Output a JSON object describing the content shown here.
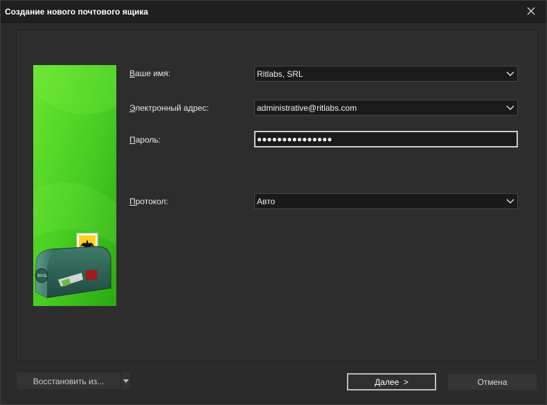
{
  "window": {
    "title": "Создание нового почтового ящика",
    "close_icon": "close-icon"
  },
  "banner": {
    "image": "mailbox-with-bat-stamp-illustration",
    "colors": {
      "green_top": "#5fe02d",
      "green_bottom": "#2fb516"
    }
  },
  "form": {
    "name": {
      "label": "Ваше имя:",
      "mnemonic": "В",
      "rest": "аше имя:",
      "value": "Ritlabs, SRL"
    },
    "email": {
      "label": "Электронный адрес:",
      "mnemonic": "Э",
      "rest": "лектронный адрес:",
      "value": "administrative@ritlabs.com"
    },
    "password": {
      "label": "Пароль:",
      "mnemonic": "П",
      "rest": "ароль:",
      "value": "●●●●●●●●●●●●●●●"
    },
    "protocol": {
      "label": "Протокол:",
      "mnemonic": "П",
      "rest": "ротокол:",
      "value": "Авто"
    }
  },
  "footer": {
    "restore_label": "Восстановить из...",
    "next_label": "Далее >",
    "next_mnemonic": "Д",
    "next_rest": "алее  >",
    "cancel_label": "Отмена"
  },
  "colors": {
    "background": "#2b2b2b",
    "titlebar": "#1f1f1f",
    "field": "#1a1a1a",
    "focus_border": "#cfcfcf"
  }
}
